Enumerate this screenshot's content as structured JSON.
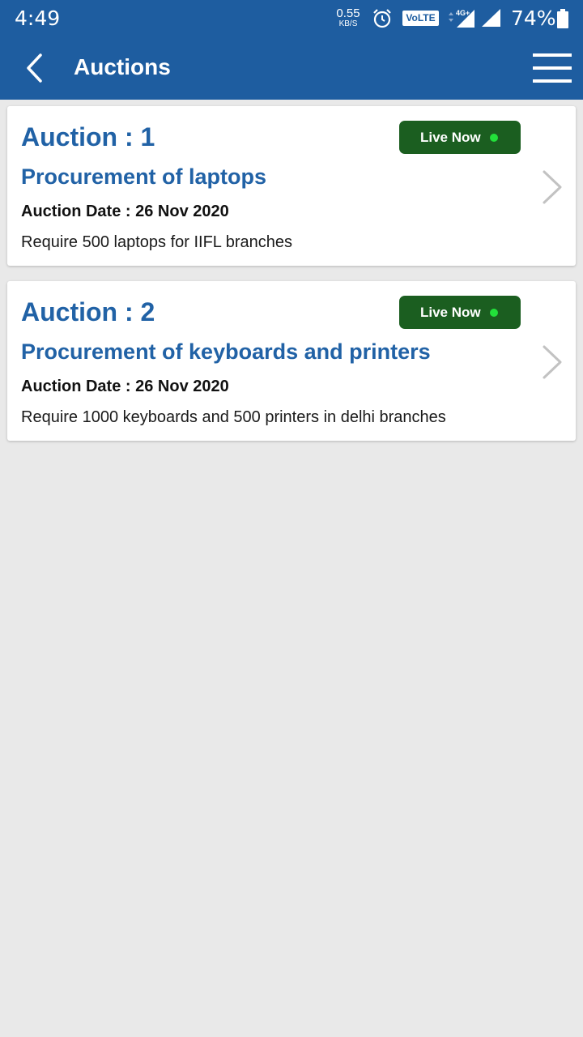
{
  "status_bar": {
    "time": "4:49",
    "net_speed_value": "0.55",
    "net_speed_unit": "KB/S",
    "volte_label": "VoLTE",
    "network_type": "4G+",
    "battery_percent": "74%",
    "icons": [
      "alarm-icon",
      "signal-icon",
      "battery-icon"
    ]
  },
  "app_bar": {
    "title": "Auctions",
    "back_icon": "back-arrow-icon",
    "menu_icon": "hamburger-menu-icon",
    "color": "#1e5da0"
  },
  "auctions": [
    {
      "heading": "Auction : 1",
      "status": "Live Now",
      "title": "Procurement of laptops",
      "date": "Auction Date : 26 Nov 2020",
      "description": "Require 500 laptops for IIFL branches"
    },
    {
      "heading": "Auction : 2",
      "status": "Live Now",
      "title": "Procurement of keyboards and printers",
      "date": "Auction Date : 26 Nov 2020",
      "description": "Require 1000 keyboards and 500 printers in delhi branches"
    }
  ],
  "colors": {
    "accent": "#2162a6",
    "live_badge": "#1b5e20",
    "live_dot": "#22e03a",
    "background": "#e9e9e9"
  }
}
